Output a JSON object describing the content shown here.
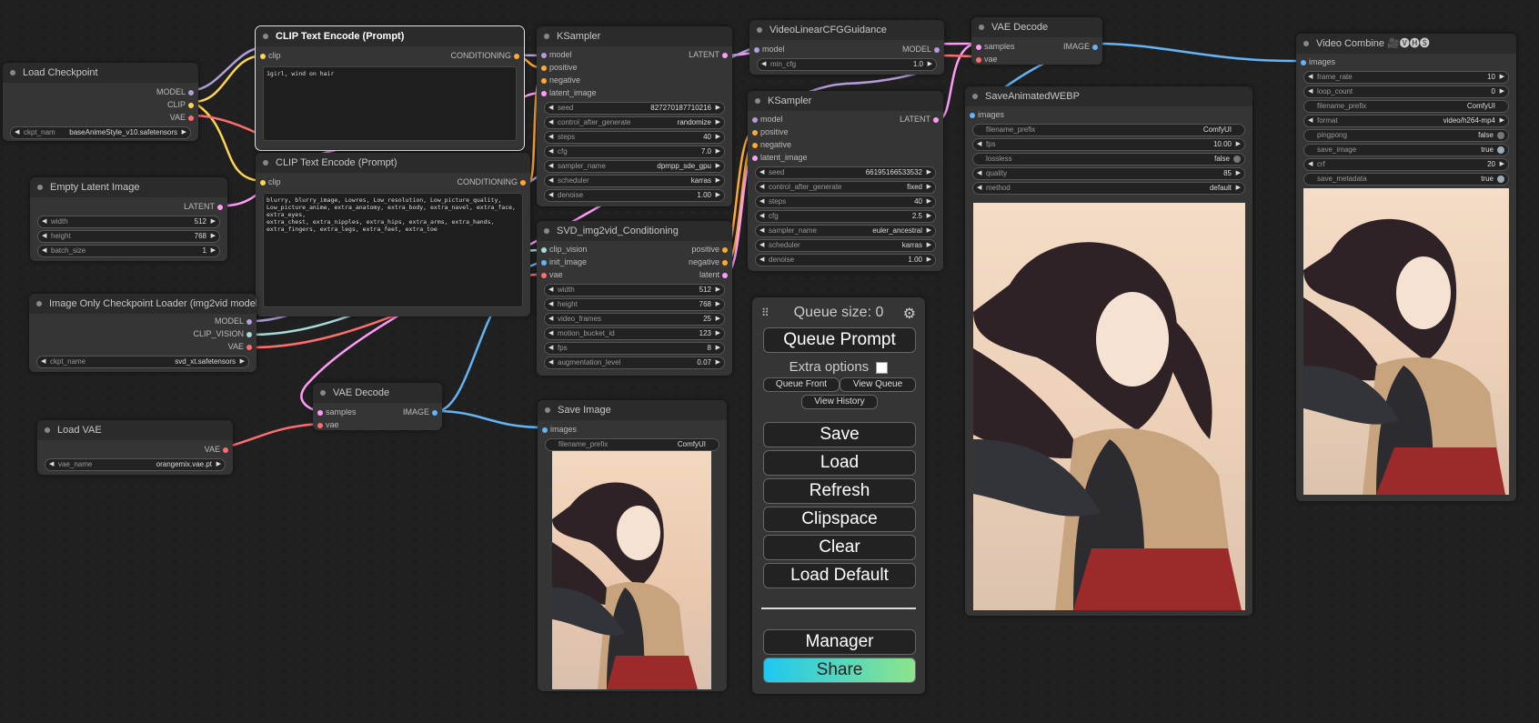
{
  "load_checkpoint": {
    "title": "Load Checkpoint",
    "out_model": "MODEL",
    "out_clip": "CLIP",
    "out_vae": "VAE",
    "ckpt_label": "ckpt_nam",
    "ckpt_value": "baseAnimeStyle_v10.safetensors"
  },
  "clip_pos": {
    "title": "CLIP Text Encode (Prompt)",
    "in_clip": "clip",
    "out": "CONDITIONING",
    "text": "1girl, wind on hair"
  },
  "clip_neg": {
    "title": "CLIP Text Encode (Prompt)",
    "in_clip": "clip",
    "out": "CONDITIONING",
    "text": "blurry, blurry_image, Lowres, Low_resolution, Low_picture_quality, Low_picture_anime, extra_anatomy, extra_body, extra_navel, extra_face, extra_eyes,\nextra_chest, extra_nipples, extra_hips, extra_arms, extra_hands, extra_fingers, extra_legs, extra_feet, extra_toe"
  },
  "empty_latent": {
    "title": "Empty Latent Image",
    "out": "LATENT",
    "widgets": [
      {
        "label": "width",
        "value": "512"
      },
      {
        "label": "height",
        "value": "768"
      },
      {
        "label": "batch_size",
        "value": "1"
      }
    ]
  },
  "img_only_ckpt": {
    "title": "Image Only Checkpoint Loader (img2vid model)",
    "out_model": "MODEL",
    "out_clipvision": "CLIP_VISION",
    "out_vae": "VAE",
    "ckpt_label": "ckpt_name",
    "ckpt_value": "svd_xt.safetensors"
  },
  "load_vae": {
    "title": "Load VAE",
    "out": "VAE",
    "vae_label": "vae_name",
    "vae_value": "orangemix.vae.pt"
  },
  "ksampler1": {
    "title": "KSampler",
    "inputs": [
      "model",
      "positive",
      "negative",
      "latent_image"
    ],
    "out": "LATENT",
    "widgets": [
      {
        "label": "seed",
        "value": "827270187710216"
      },
      {
        "label": "control_after_generate",
        "value": "randomize"
      },
      {
        "label": "steps",
        "value": "40"
      },
      {
        "label": "cfg",
        "value": "7.0"
      },
      {
        "label": "sampler_name",
        "value": "dpmpp_sde_gpu"
      },
      {
        "label": "scheduler",
        "value": "karras"
      },
      {
        "label": "denoise",
        "value": "1.00"
      }
    ]
  },
  "svd_cond": {
    "title": "SVD_img2vid_Conditioning",
    "inputs": [
      "clip_vision",
      "init_image",
      "vae"
    ],
    "outputs": [
      "positive",
      "negative",
      "latent"
    ],
    "widgets": [
      {
        "label": "width",
        "value": "512"
      },
      {
        "label": "height",
        "value": "768"
      },
      {
        "label": "video_frames",
        "value": "25"
      },
      {
        "label": "motion_bucket_id",
        "value": "123"
      },
      {
        "label": "fps",
        "value": "8"
      },
      {
        "label": "augmentation_level",
        "value": "0.07"
      }
    ]
  },
  "vae_decode1": {
    "title": "VAE Decode",
    "in_samples": "samples",
    "in_vae": "vae",
    "out": "IMAGE"
  },
  "save_image": {
    "title": "Save Image",
    "in": "images",
    "prefix_label": "filename_prefix",
    "prefix_value": "ComfyUI"
  },
  "vlcfg": {
    "title": "VideoLinearCFGGuidance",
    "in": "model",
    "out": "MODEL",
    "widget_label": "min_cfg",
    "widget_value": "1.0"
  },
  "ksampler2": {
    "title": "KSampler",
    "inputs": [
      "model",
      "positive",
      "negative",
      "latent_image"
    ],
    "out": "LATENT",
    "widgets": [
      {
        "label": "seed",
        "value": "66195166533532"
      },
      {
        "label": "control_after_generate",
        "value": "fixed"
      },
      {
        "label": "steps",
        "value": "40"
      },
      {
        "label": "cfg",
        "value": "2.5"
      },
      {
        "label": "sampler_name",
        "value": "euler_ancestral"
      },
      {
        "label": "scheduler",
        "value": "karras"
      },
      {
        "label": "denoise",
        "value": "1.00"
      }
    ]
  },
  "vae_decode2": {
    "title": "VAE Decode",
    "in_samples": "samples",
    "in_vae": "vae",
    "out": "IMAGE"
  },
  "save_webp": {
    "title": "SaveAnimatedWEBP",
    "in": "images",
    "widgets": [
      {
        "label": "filename_prefix",
        "value": "ComfyUI"
      },
      {
        "label": "fps",
        "value": "10.00"
      },
      {
        "label": "lossless",
        "value": "false"
      },
      {
        "label": "quality",
        "value": "85"
      },
      {
        "label": "method",
        "value": "default"
      }
    ]
  },
  "video_combine": {
    "title": "Video Combine 🎥🅥🅗🅢",
    "in": "images",
    "widgets": [
      {
        "label": "frame_rate",
        "value": "10"
      },
      {
        "label": "loop_count",
        "value": "0"
      },
      {
        "label": "filename_prefix",
        "value": "ComfyUI"
      },
      {
        "label": "format",
        "value": "video/h264-mp4"
      },
      {
        "label": "pingpong",
        "value": "false"
      },
      {
        "label": "save_image",
        "value": "true"
      },
      {
        "label": "crf",
        "value": "20"
      },
      {
        "label": "save_metadata",
        "value": "true"
      }
    ]
  },
  "menu": {
    "queue_size": "Queue size: 0",
    "queue_prompt": "Queue Prompt",
    "extra_options": "Extra options",
    "queue_front": "Queue Front",
    "view_queue": "View Queue",
    "view_history": "View History",
    "save": "Save",
    "load": "Load",
    "refresh": "Refresh",
    "clipspace": "Clipspace",
    "clear": "Clear",
    "load_default": "Load Default",
    "manager": "Manager",
    "share": "Share"
  },
  "colors": {
    "background": "#202020",
    "node": "#353535",
    "model": "#b39ddb",
    "clip": "#ffd54f",
    "vae": "#ff6e6e",
    "conditioning": "#ffa931",
    "latent": "#ff9cf9",
    "image": "#64b5f6",
    "clip_vision": "#a8dadc",
    "share_gradient_start": "#1ec8f0",
    "share_gradient_end": "#8de48a"
  }
}
